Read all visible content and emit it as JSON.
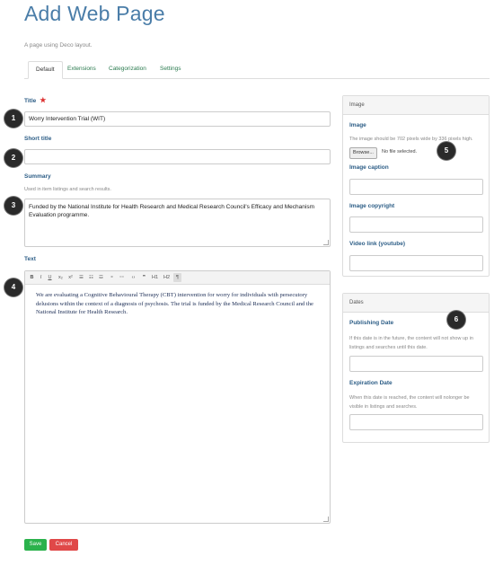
{
  "header": {
    "title": "Add Web Page",
    "description": "A page using Deco layout."
  },
  "tabs": [
    {
      "label": "Default",
      "active": true
    },
    {
      "label": "Extensions",
      "active": false
    },
    {
      "label": "Categorization",
      "active": false
    },
    {
      "label": "Settings",
      "active": false
    }
  ],
  "form": {
    "title": {
      "label": "Title",
      "required_marker": "★",
      "value": "Worry Intervention Trial (WIT)"
    },
    "short_title": {
      "label": "Short title",
      "value": ""
    },
    "summary": {
      "label": "Summary",
      "help": "Used in item listings and search results.",
      "value": "Funded by the National Institute for Health Research and Medical Research Council's Efficacy and Mechanism Evaluation programme."
    },
    "text": {
      "label": "Text",
      "toolbar": [
        "B",
        "I",
        "U",
        "x₂",
        "x²",
        "☰",
        "☷",
        "☲",
        "⚭",
        "⚯",
        "‹›",
        "❞",
        "H1",
        "H2",
        "¶"
      ],
      "body": "We are evaluating a Cognitive Behavioural Therapy (CBT) intervention for worry for individuals with persecutory delusions within the context of a diagnosis of psychosis. The trial is funded by the Medical Research Council and the National Institute for Health Research."
    }
  },
  "image_panel": {
    "heading": "Image",
    "image_label": "Image",
    "image_help": "The image should be 702 pixels wide by 336 pixels high.",
    "browse_label": "Browse...",
    "no_file": "No file selected.",
    "caption_label": "Image caption",
    "copyright_label": "Image copyright",
    "video_label": "Video link (youtube)"
  },
  "dates_panel": {
    "heading": "Dates",
    "publishing_label": "Publishing Date",
    "publishing_help": "If this date is in the future, the content will not show up in listings and searches until this date.",
    "expiration_label": "Expiration Date",
    "expiration_help": "When this date is reached, the content will nolonger be visible in listings and searches."
  },
  "actions": {
    "save": "Save",
    "cancel": "Cancel"
  },
  "callouts": [
    "1",
    "2",
    "3",
    "4",
    "5",
    "6"
  ],
  "colors": {
    "title": "#4a7da8",
    "label": "#2c5d86",
    "tab_link": "#2a7a4e",
    "save": "#2bb24c",
    "cancel": "#e04848",
    "callout": "#2a2a2a"
  }
}
